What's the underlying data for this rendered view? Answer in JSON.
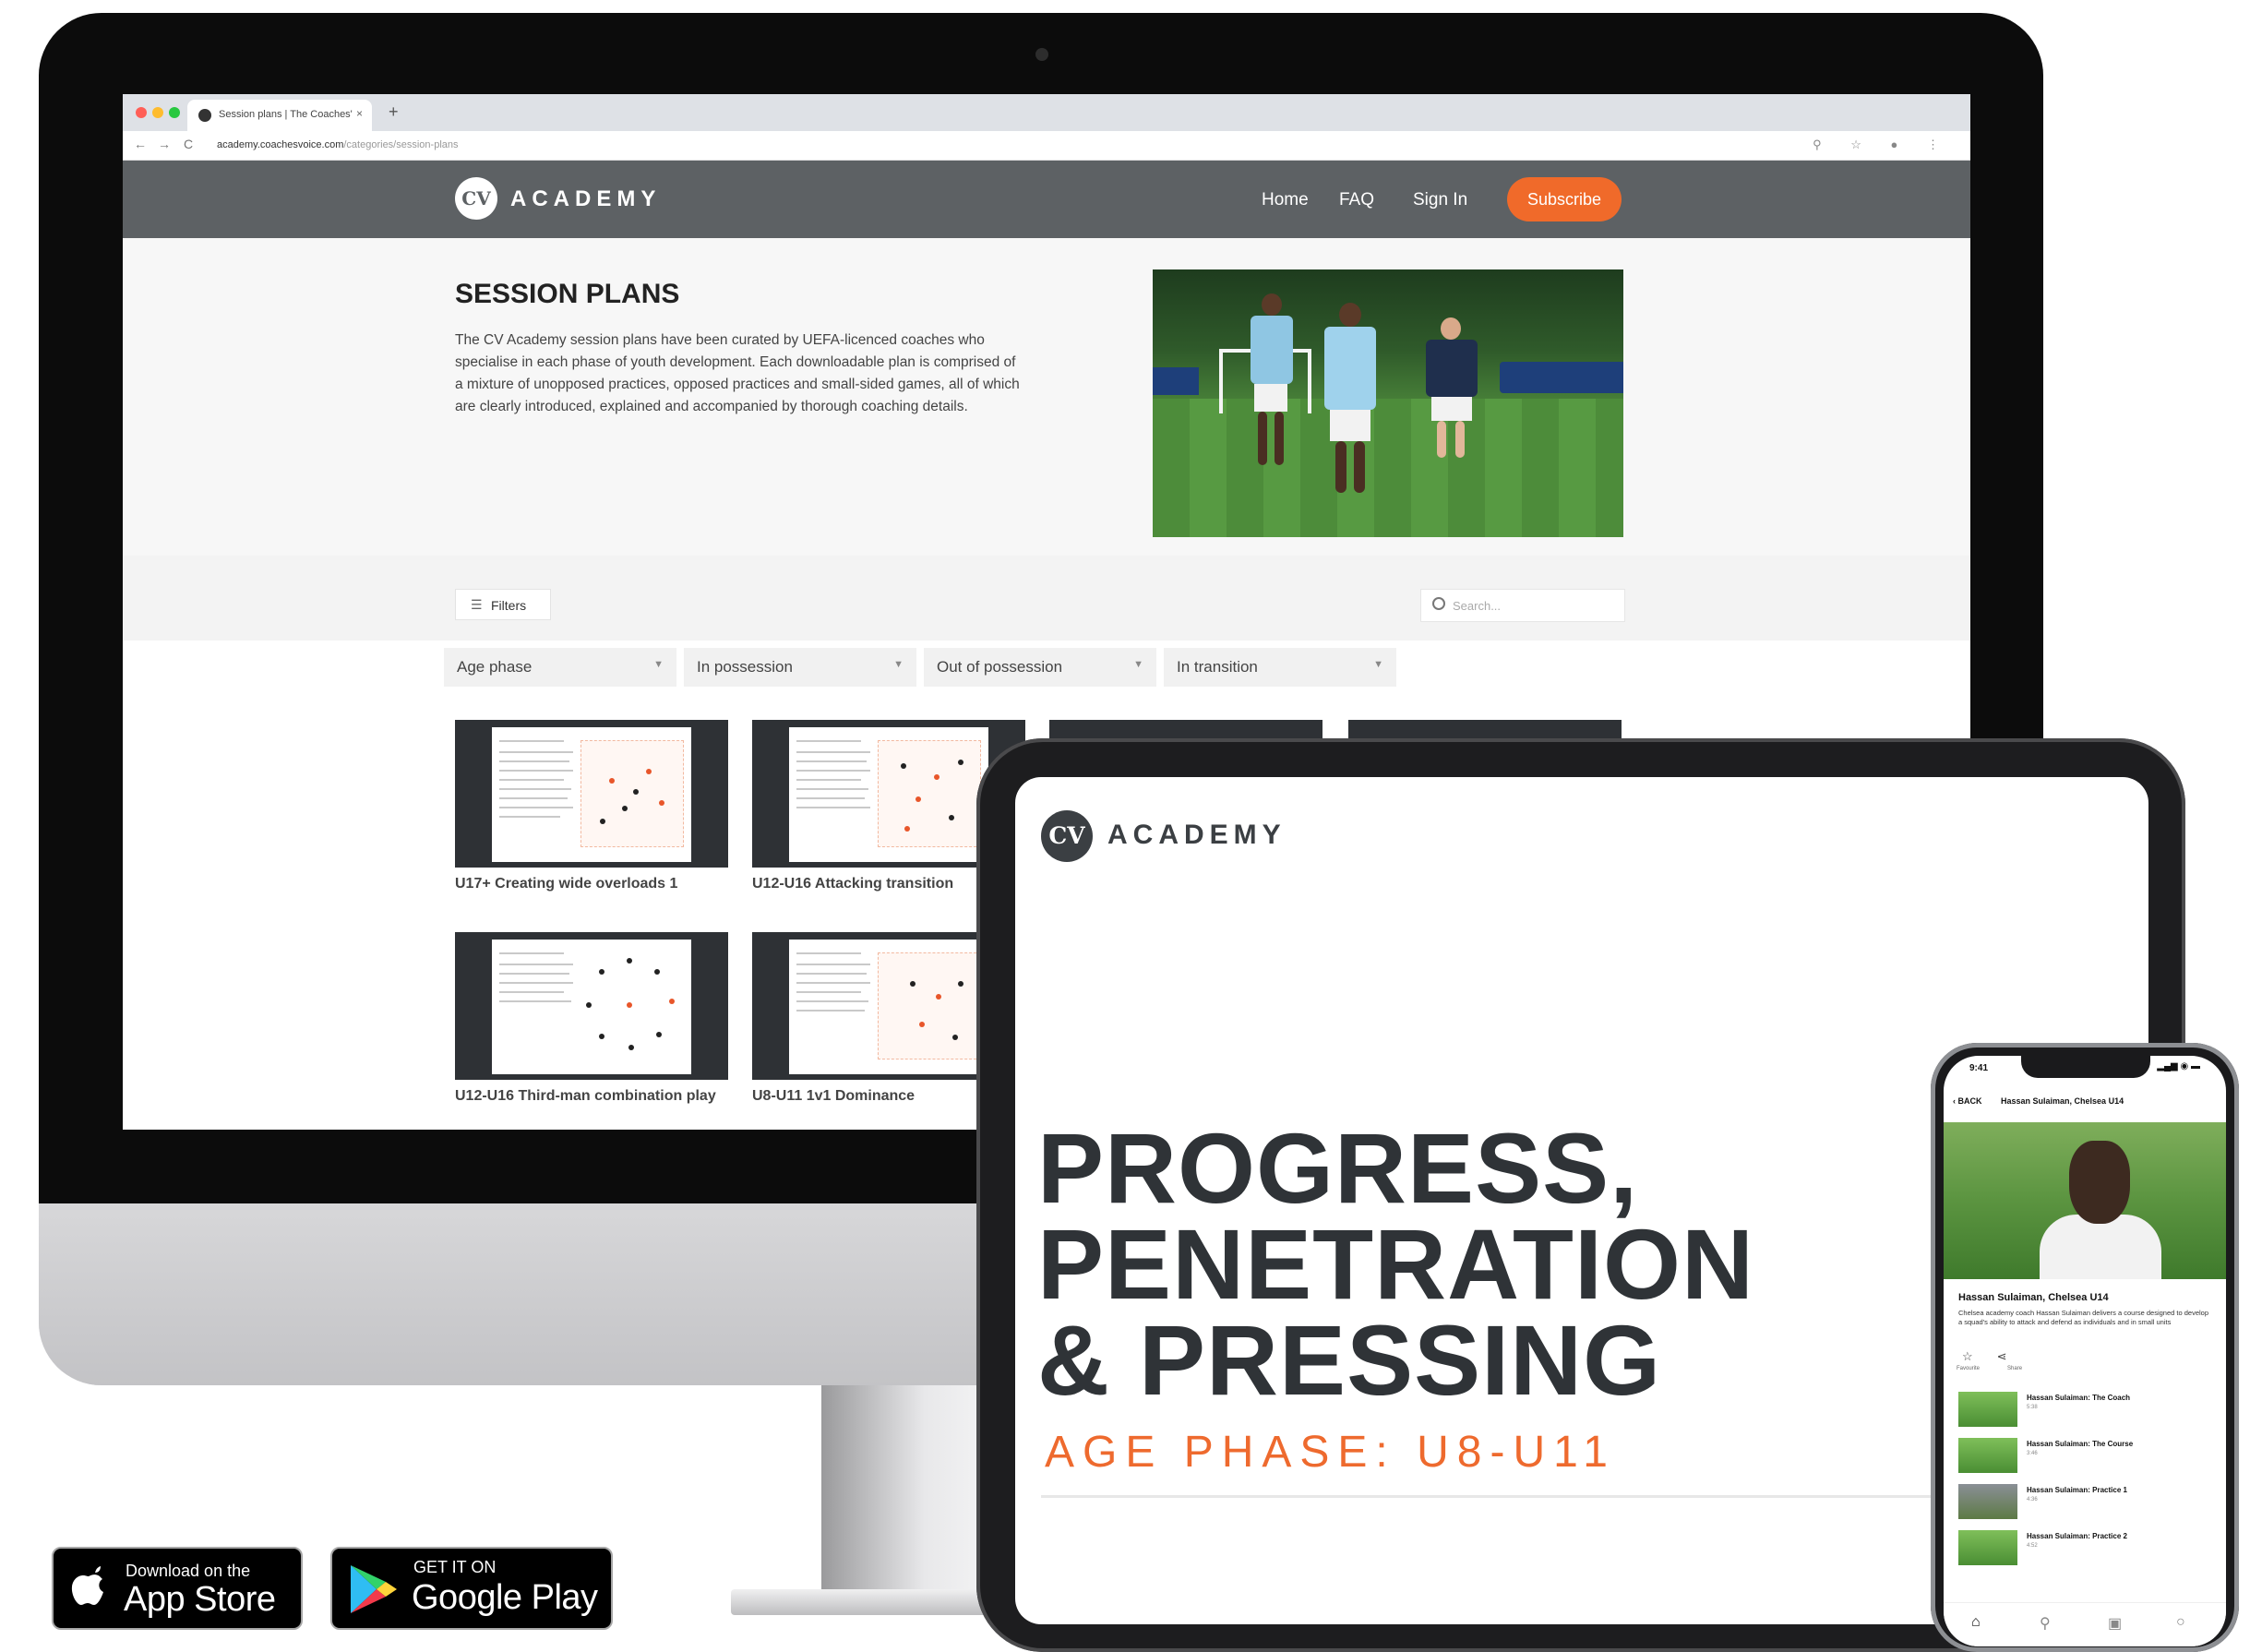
{
  "browser": {
    "tab_title": "Session plans | The Coaches'",
    "tab_close": "×",
    "new_tab": "+",
    "url_host": "academy.coachesvoice.com",
    "url_path": "/categories/session-plans",
    "nav_back": "←",
    "nav_forward": "→",
    "nav_reload": "C",
    "ext_icons": "⚲ ☆ ● ⋮"
  },
  "site": {
    "logo_mark": "CV",
    "logo_text": "ACADEMY",
    "nav": [
      "Home",
      "FAQ",
      "Sign In"
    ],
    "subscribe": "Subscribe",
    "brand_color": "#f06a2a"
  },
  "page": {
    "title": "SESSION PLANS",
    "intro": "The CV Academy session plans have been curated by UEFA-licenced coaches who specialise in each phase of youth development. Each downloadable plan is comprised of a mixture of unopposed practices, opposed practices and small-sided games, all of which are clearly introduced, explained and accompanied by thorough coaching details.",
    "filters_label": "Filters",
    "search_placeholder": "Search...",
    "selects": [
      "Age phase",
      "In possession",
      "Out of possession",
      "In transition"
    ],
    "cards": [
      "U17+ Creating wide overloads 1",
      "U12-U16 Attacking transition",
      "U12-U16 Third-man combination play",
      "U8-U11 1v1 Dominance"
    ]
  },
  "tablet": {
    "logo_mark": "CV",
    "logo_text": "ACADEMY",
    "headline_lines": [
      "PROGRESS,",
      "PENETRATION",
      "& PRESSING"
    ],
    "subheading": "AGE PHASE: U8-U11",
    "accent_color": "#ee6a2e"
  },
  "phone": {
    "time": "9:41",
    "status": "▂▄▆ ◉ ▬",
    "back": "BACK",
    "top_title": "Hassan Sulaiman, Chelsea U14",
    "name": "Hassan Sulaiman, Chelsea U14",
    "description": "Chelsea academy coach Hassan Sulaiman delivers a course designed to develop a squad's ability to attack and defend as individuals and in small units",
    "actions": [
      "☆",
      "⋖"
    ],
    "action_labels": [
      "Favourite",
      "Share"
    ],
    "items": [
      {
        "title": "Hassan Sulaiman: The Coach",
        "sub": "5:38"
      },
      {
        "title": "Hassan Sulaiman: The Course",
        "sub": "3:46"
      },
      {
        "title": "Hassan Sulaiman: Practice 1",
        "sub": "4:36"
      },
      {
        "title": "Hassan Sulaiman: Practice 2",
        "sub": "4:52"
      }
    ],
    "tabs": [
      "⌂",
      "⚲",
      "▣",
      "○"
    ]
  },
  "badges": {
    "appstore_small": "Download on the",
    "appstore_big": "App Store",
    "play_small": "GET IT ON",
    "play_big": "Google Play"
  }
}
